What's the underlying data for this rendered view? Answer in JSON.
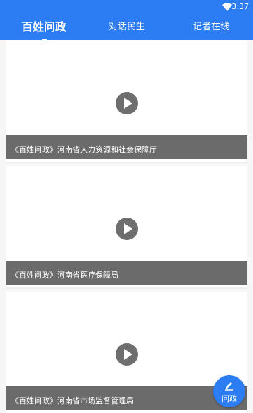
{
  "status_bar": {
    "time": "3:37",
    "wifi_icon": "wifi-icon"
  },
  "tabs": [
    {
      "label": "百姓问政",
      "selected": true
    },
    {
      "label": "对话民生",
      "selected": false
    },
    {
      "label": "记者在线",
      "selected": false
    }
  ],
  "videos": [
    {
      "title": "《百姓问政》河南省人力资源和社会保障厅",
      "icon": "play-icon"
    },
    {
      "title": "《百姓问政》河南省医疗保障局",
      "icon": "play-icon"
    },
    {
      "title": "《百姓问政》河南省市场监督管理局",
      "icon": "play-icon"
    }
  ],
  "fab": {
    "label": "问政",
    "icon": "edit-icon"
  },
  "colors": {
    "primary": "#2c7cf3",
    "caption_bg": "#6b6b6b",
    "play_bg": "#6e6e6e"
  }
}
